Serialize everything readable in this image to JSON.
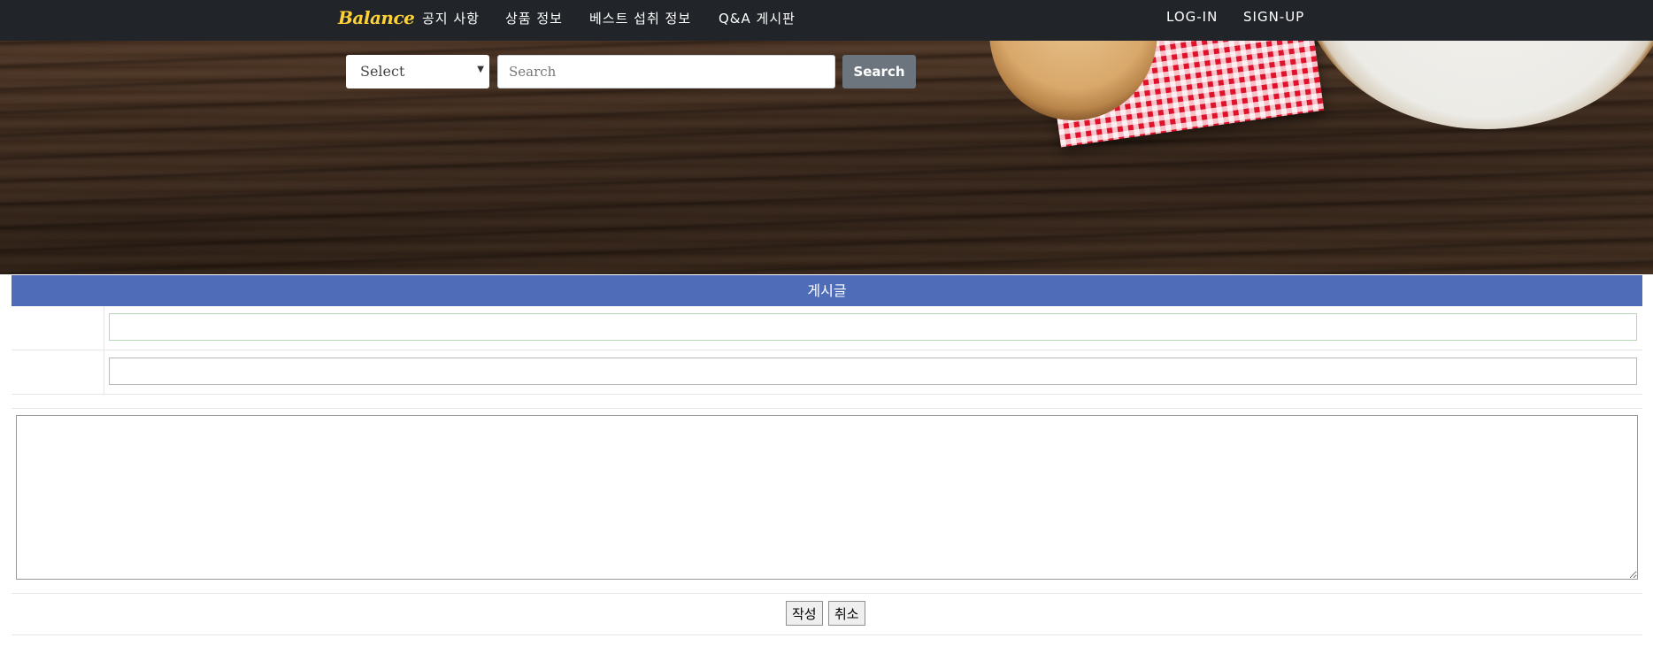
{
  "navbar": {
    "brand": "Balance",
    "links": [
      "공지 사항",
      "상품 정보",
      "베스트 섭취 정보",
      "Q&A 게시판"
    ],
    "login": "LOG-IN",
    "signup": "SIGN-UP"
  },
  "search": {
    "select_value": "Select",
    "placeholder": "Search",
    "button": "Search"
  },
  "board": {
    "header": "게시글",
    "submit": "작성",
    "cancel": "취소"
  },
  "colors": {
    "navbar_bg": "#212529",
    "brand": "#fed136",
    "board_header": "#4e6cb8",
    "search_button": "#6c757d"
  }
}
